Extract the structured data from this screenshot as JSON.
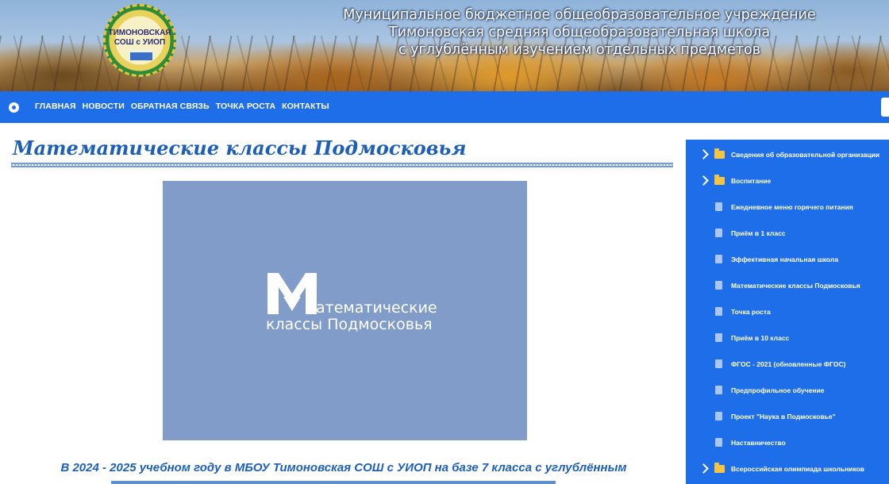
{
  "header": {
    "logo_text": "ТИМОНОВСКАЯ СОШ с УИОП",
    "school_title_lines": [
      "Муниципальное бюджетное общеобразовательное учреждение",
      "Тимоновская средняя общеобразовательная школа",
      "с углублённым изучением отдельных предметов"
    ]
  },
  "nav": {
    "items": [
      "Главная",
      "Новости",
      "Обратная связь",
      "Точка роста",
      "Контакты"
    ]
  },
  "main": {
    "page_title": "Математические классы Подмосковья",
    "hero": {
      "line1": "атематические",
      "line2": "классы Подмосковья"
    },
    "body_text": "В 2024 - 2025 учебном году в МБОУ Тимоновская СОШ с УИОП на базе 7 класса с углублённым"
  },
  "sidebar": {
    "items": [
      {
        "label": "Сведения об образовательной организации",
        "type": "folder"
      },
      {
        "label": "Воспитание",
        "type": "folder"
      },
      {
        "label": "Ежедневное меню горячего питания",
        "type": "doc"
      },
      {
        "label": "Приём в 1 класс",
        "type": "doc"
      },
      {
        "label": "Эффективная начальная школа",
        "type": "doc"
      },
      {
        "label": "Математические классы Подмосковья",
        "type": "doc"
      },
      {
        "label": "Точка роста",
        "type": "doc"
      },
      {
        "label": "Приём в 10 класс",
        "type": "doc"
      },
      {
        "label": "ФГОС - 2021 (обновленные ФГОС)",
        "type": "doc"
      },
      {
        "label": "Предпрофильное обучение",
        "type": "doc"
      },
      {
        "label": "Проект \"Наука в Подмосковье\"",
        "type": "doc"
      },
      {
        "label": "Наставничество",
        "type": "doc"
      },
      {
        "label": "Всероссийская олимпиада школьников",
        "type": "folder"
      },
      {
        "label": "",
        "type": "folder"
      }
    ]
  },
  "colors": {
    "nav_bg": "#1f6ee9",
    "title_blue": "#1d5fb8",
    "hero_bg": "#819cc9",
    "folder": "#f4c542"
  }
}
